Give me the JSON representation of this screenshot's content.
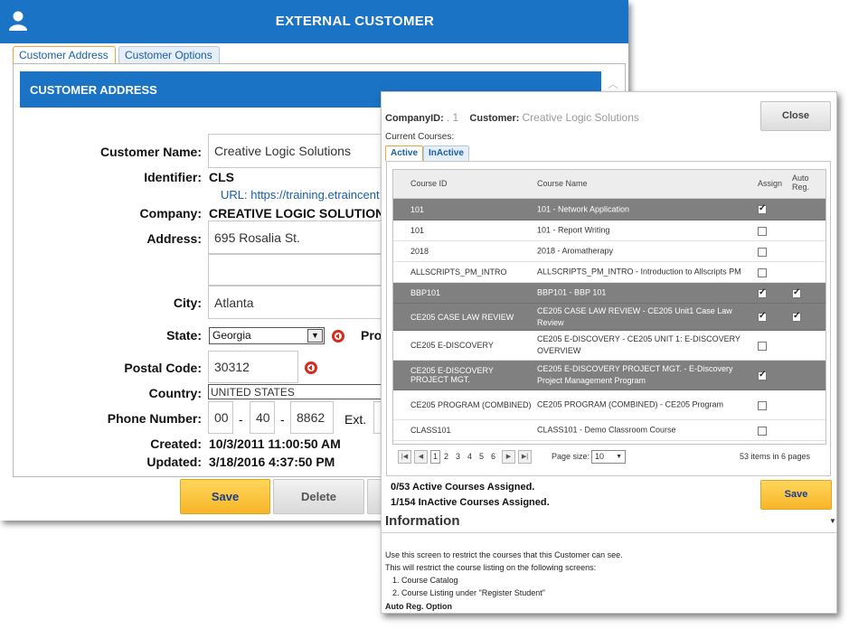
{
  "back_window": {
    "title": "EXTERNAL CUSTOMER",
    "tabs": [
      {
        "label": "Customer Address"
      },
      {
        "label": "Customer Options"
      }
    ],
    "section_title": "CUSTOMER ADDRESS",
    "labels": {
      "customer_name": "Customer Name:",
      "identifier": "Identifier:",
      "company": "Company:",
      "address": "Address:",
      "city": "City:",
      "state": "State:",
      "prov": "Pro",
      "postal_code": "Postal Code:",
      "country": "Country:",
      "phone": "Phone Number:",
      "created": "Created:",
      "updated": "Updated:",
      "ext": "Ext."
    },
    "values": {
      "customer_name": "Creative Logic Solutions",
      "identifier": "CLS",
      "url": "URL: https://training.etraincent",
      "company": "CREATIVE LOGIC SOLUTION",
      "address1": "695 Rosalia St.",
      "address2": "",
      "city": "Atlanta",
      "state": "Georgia",
      "postal_code": "30312",
      "country": "UNITED STATES",
      "phone1": "00",
      "phone2": "40",
      "phone3": "8862",
      "phone_sep": "-",
      "created": "10/3/2011 11:00:50 AM",
      "updated": "3/18/2016 4:37:50 PM"
    },
    "buttons": {
      "save": "Save",
      "delete": "Delete"
    }
  },
  "dialog": {
    "company_id_label": "CompanyID:",
    "company_id": ". 1",
    "customer_label": "Customer:",
    "customer_name": "Creative Logic Solutions",
    "close_label": "Close",
    "current_courses": "Current Courses:",
    "tabs": [
      {
        "label": "Active"
      },
      {
        "label": "InActive"
      }
    ],
    "columns": {
      "course_id": "Course ID",
      "course_name": "Course Name",
      "assign": "Assign",
      "auto_reg": "Auto Reg."
    },
    "rows": [
      {
        "id": "101",
        "name": "101 - Network Application",
        "assign": true,
        "auto": false,
        "selected": true
      },
      {
        "id": "101",
        "name": "101 - Report Writing",
        "assign": false,
        "auto": false,
        "selected": false
      },
      {
        "id": "2018",
        "name": "2018 - Aromatherapy",
        "assign": false,
        "auto": false,
        "selected": false
      },
      {
        "id": "ALLSCRIPTS_PM_INTRO",
        "name": "ALLSCRIPTS_PM_INTRO - Introduction to Allscripts PM",
        "assign": false,
        "auto": false,
        "selected": false
      },
      {
        "id": "BBP101",
        "name": "BBP101 - BBP 101",
        "assign": true,
        "auto": true,
        "selected": true
      },
      {
        "id": "CE205 CASE LAW REVIEW",
        "name": "CE205 CASE LAW REVIEW - CE205 Unit1 Case Law Review",
        "assign": true,
        "auto": true,
        "selected": true
      },
      {
        "id": "CE205 E-DISCOVERY",
        "name": "CE205 E-DISCOVERY - CE205 UNIT 1: E-DISCOVERY OVERVIEW",
        "assign": false,
        "auto": false,
        "selected": false
      },
      {
        "id": "CE205 E-DISCOVERY PROJECT MGT.",
        "name": "CE205 E-DISCOVERY PROJECT MGT. - E-Discovery Project Management Program",
        "assign": true,
        "auto": false,
        "selected": true
      },
      {
        "id": "CE205 PROGRAM (COMBINED)",
        "name": "CE205 PROGRAM (COMBINED) - CE205 Program",
        "assign": false,
        "auto": false,
        "selected": false
      },
      {
        "id": "CLASS101",
        "name": "CLASS101 - Demo Classroom Course",
        "assign": false,
        "auto": false,
        "selected": false
      }
    ],
    "pager": {
      "pages": [
        "1",
        "2",
        "3",
        "4",
        "5",
        "6"
      ],
      "page_size_label": "Page size:",
      "page_size": "10",
      "summary": "53 items in 6 pages"
    },
    "active_assigned": "0/53 Active Courses Assigned.",
    "inactive_assigned": "1/154 InActive Courses Assigned.",
    "save_label": "Save",
    "info_title": "Information",
    "info_lines": [
      "Use this screen to restrict the courses that this Customer can see.",
      "This will restrict the course listing on the following screens:",
      "1.   Course Catalog",
      "2.   Course Listing under \"Register Student\""
    ],
    "auto_reg_option": "Auto Reg. Option"
  }
}
